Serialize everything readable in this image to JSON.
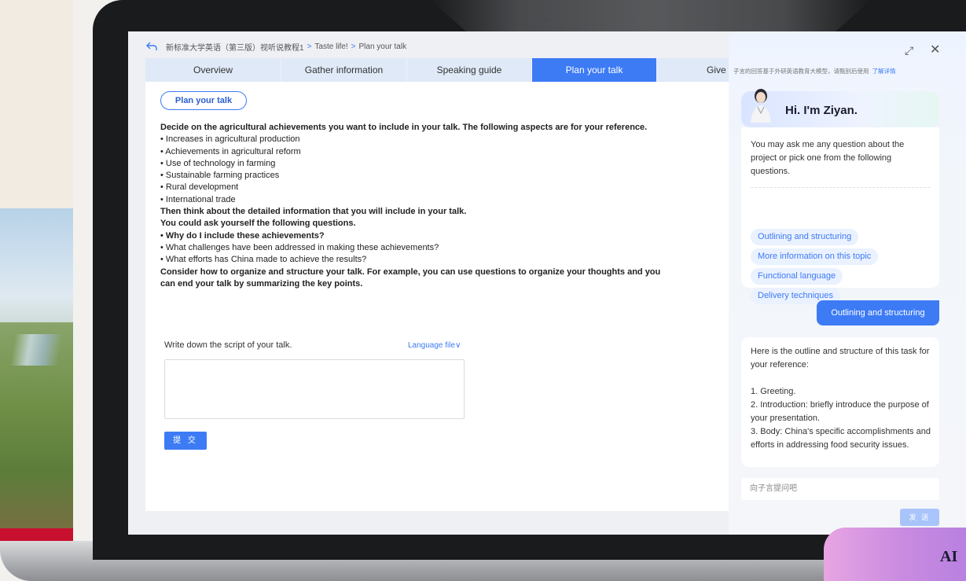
{
  "breadcrumb": {
    "course": "新标准大学英语（第三版）视听说教程1",
    "unit": "Taste life!",
    "page": "Plan your talk",
    "separator": ">"
  },
  "tabs": [
    {
      "label": "Overview",
      "active": false
    },
    {
      "label": "Gather information",
      "active": false
    },
    {
      "label": "Speaking guide",
      "active": false
    },
    {
      "label": "Plan  your talk",
      "active": true
    },
    {
      "label": "Give y",
      "active": false
    }
  ],
  "section_pill": "Plan your talk",
  "instructions": [
    {
      "text": "Decide on the agricultural achievements you want to include in your talk. The following aspects are for your reference.",
      "bold": true
    },
    {
      "text": "• Increases in agricultural production",
      "bold": false
    },
    {
      "text": "• Achievements in agricultural reform",
      "bold": false
    },
    {
      "text": "• Use of technology in farming",
      "bold": false
    },
    {
      "text": "• Sustainable farming practices",
      "bold": false
    },
    {
      "text": "• Rural development",
      "bold": false
    },
    {
      "text": "• International trade",
      "bold": false
    },
    {
      "text": "Then think about the detailed information that you will include in your talk.",
      "bold": true
    },
    {
      "text": "You could ask yourself the following questions.",
      "bold": true
    },
    {
      "text": "• Why do I include these achievements?",
      "bold": true
    },
    {
      "text": "• What challenges have been addressed in making these achievements?",
      "bold": false
    },
    {
      "text": "• What efforts has China made to achieve the results?",
      "bold": false
    },
    {
      "text": "Consider how to organize and structure your talk. For example, you can use questions to organize your thoughts and you",
      "bold": true
    },
    {
      "text": "can end your talk by summarizing the key points.",
      "bold": true
    }
  ],
  "script_prompt": "Write down the script of your talk.",
  "language_file": "Language file",
  "script_value": "",
  "submit_label": "提 交",
  "chat": {
    "notice": "子言的回答基于外研英语教育大模型，请甄别后使用",
    "notice_link": "了解详情",
    "greeting": "Hi. I'm Ziyan.",
    "intro": "You may ask me any question about the project or pick one from the following questions.",
    "suggestions": [
      "Outlining and structuring",
      "More information on this topic",
      "Functional language",
      "Delivery techniques"
    ],
    "user_message": "Outlining and structuring",
    "reply_lines": [
      "Here is the outline and structure of this task for your reference:",
      "",
      "1. Greeting.",
      "2. Introduction: briefly introduce the purpose of your presentation.",
      "3. Body: China's specific accomplishments and efforts in addressing food security issues."
    ],
    "input_placeholder": "向子言提问吧",
    "send_label": "发 送"
  },
  "badge": "AI",
  "colors": {
    "accent": "#3d7bf5",
    "tab_bar": "#dfe9f7",
    "send_disabled": "#a8c4fb",
    "poster_red": "#c8102e"
  }
}
